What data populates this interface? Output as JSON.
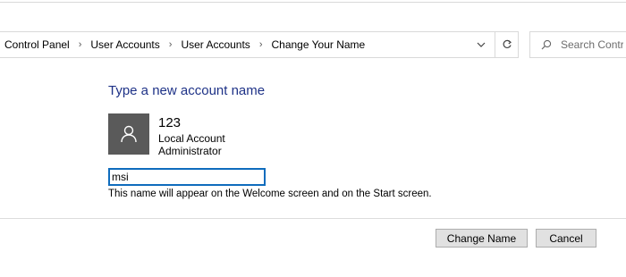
{
  "address_bar": {
    "breadcrumb": [
      "Control Panel",
      "User Accounts",
      "User Accounts",
      "Change Your Name"
    ]
  },
  "search": {
    "placeholder": "Search Contro"
  },
  "main": {
    "heading": "Type a new account name",
    "account": {
      "name": "123",
      "type": "Local Account",
      "role": "Administrator"
    },
    "new_name_value": "msi",
    "hint": "This name will appear on the Welcome screen and on the Start screen."
  },
  "buttons": {
    "change_name": "Change Name",
    "cancel": "Cancel"
  },
  "colors": {
    "heading": "#1e3287",
    "avatar_bg": "#5a5a5a",
    "input_border": "#0f6cbd"
  }
}
